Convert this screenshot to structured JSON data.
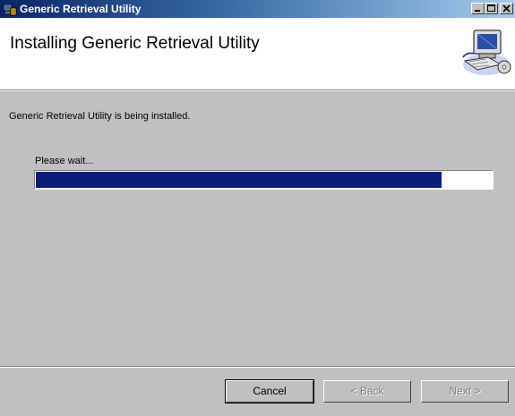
{
  "window": {
    "title": "Generic Retrieval Utility"
  },
  "header": {
    "title": "Installing Generic Retrieval Utility",
    "icon": "computer-setup-icon"
  },
  "status": {
    "message": "Generic Retrieval Utility is being installed."
  },
  "progress": {
    "label": "Please wait...",
    "value": 0.89
  },
  "buttons": {
    "cancel": "Cancel",
    "back": "< Back",
    "next": "Next >"
  },
  "colors": {
    "titlebar": "#0a246a",
    "progress_fill": "#0a1c7a",
    "background": "#c0c0c0"
  }
}
